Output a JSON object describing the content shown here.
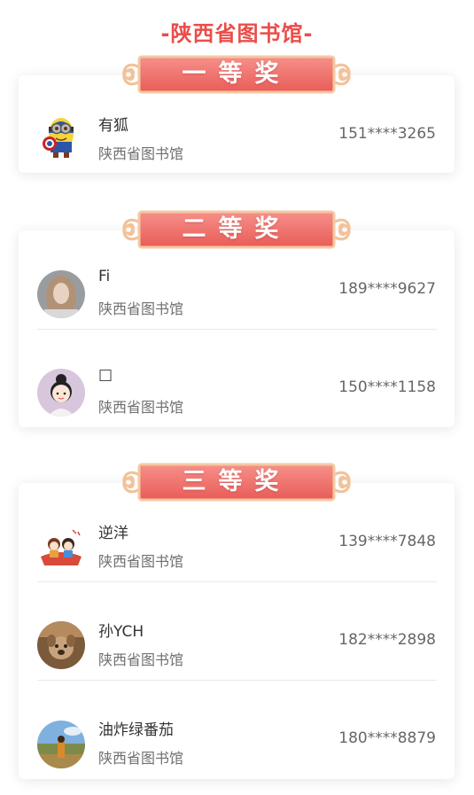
{
  "title": "-陕西省图书馆-",
  "colors": {
    "title": "#ea4d4a",
    "banner_fill": "#ee6f6b",
    "banner_border": "#f2c8a0",
    "card_bg": "#ffffff"
  },
  "sections": [
    {
      "banner": "一等奖",
      "winners": [
        {
          "name": "有狐",
          "org": "陕西省图书馆",
          "phone": "151****3265",
          "avatar": "minion-captain-avatar"
        }
      ]
    },
    {
      "banner": "二等奖",
      "winners": [
        {
          "name": "Fi",
          "org": "陕西省图书馆",
          "phone": "189****9627",
          "avatar": "girl-photo-avatar"
        },
        {
          "name": "□",
          "org": "陕西省图书馆",
          "phone": "150****1158",
          "avatar": "cartoon-girl-avatar"
        }
      ]
    },
    {
      "banner": "三等奖",
      "winners": [
        {
          "name": "逆洋",
          "org": "陕西省图书馆",
          "phone": "139****7848",
          "avatar": "cartoon-couple-avatar"
        },
        {
          "name": "孙YCH",
          "org": "陕西省图书馆",
          "phone": "182****2898",
          "avatar": "dog-photo-avatar"
        },
        {
          "name": "油炸绿番茄",
          "org": "陕西省图书馆",
          "phone": "180****8879",
          "avatar": "landscape-photo-avatar"
        }
      ]
    }
  ]
}
